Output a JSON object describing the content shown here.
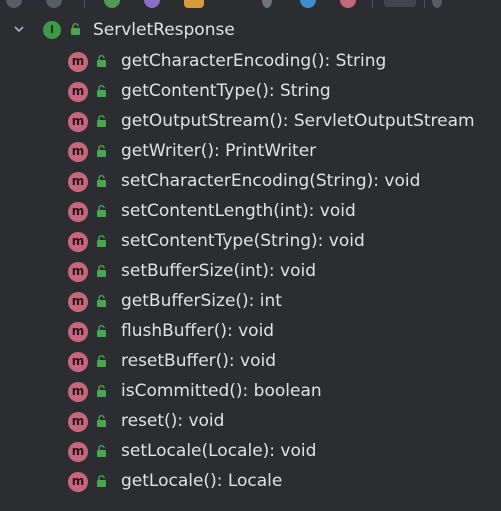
{
  "toolbar": {
    "buttons": [
      {
        "icon": "toolbar-action-icon",
        "color": "#5a5d63"
      },
      {
        "icon": "toolbar-action-icon",
        "color": "#5a5d63"
      },
      {
        "icon": "toolbar-green-icon",
        "color": "#4e9a53"
      },
      {
        "icon": "toolbar-purple-icon",
        "color": "#8a6fc2"
      },
      {
        "icon": "toolbar-orange-icon",
        "color": "#d99a3a"
      },
      {
        "icon": "toolbar-gray-icon",
        "color": "#6f737a"
      },
      {
        "icon": "toolbar-blue-icon",
        "color": "#3b8fd0"
      },
      {
        "icon": "toolbar-pink-icon",
        "color": "#c8677b"
      }
    ]
  },
  "tree": {
    "root": {
      "label": "ServletResponse",
      "kind_letter": "I",
      "expanded": true
    },
    "methods": [
      {
        "label": "getCharacterEncoding(): String",
        "letter": "m"
      },
      {
        "label": "getContentType(): String",
        "letter": "m"
      },
      {
        "label": "getOutputStream(): ServletOutputStream",
        "letter": "m"
      },
      {
        "label": "getWriter(): PrintWriter",
        "letter": "m"
      },
      {
        "label": "setCharacterEncoding(String): void",
        "letter": "m"
      },
      {
        "label": "setContentLength(int): void",
        "letter": "m"
      },
      {
        "label": "setContentType(String): void",
        "letter": "m"
      },
      {
        "label": "setBufferSize(int): void",
        "letter": "m"
      },
      {
        "label": "getBufferSize(): int",
        "letter": "m"
      },
      {
        "label": "flushBuffer(): void",
        "letter": "m"
      },
      {
        "label": "resetBuffer(): void",
        "letter": "m"
      },
      {
        "label": "isCommitted(): boolean",
        "letter": "m"
      },
      {
        "label": "reset(): void",
        "letter": "m"
      },
      {
        "label": "setLocale(Locale): void",
        "letter": "m"
      },
      {
        "label": "getLocale(): Locale",
        "letter": "m"
      }
    ]
  },
  "colors": {
    "background": "#2b2d30",
    "text": "#dfe1e5",
    "method_icon": "#c8677b",
    "interface_icon": "#3d9a4a",
    "lock_icon": "#4aa64f"
  }
}
